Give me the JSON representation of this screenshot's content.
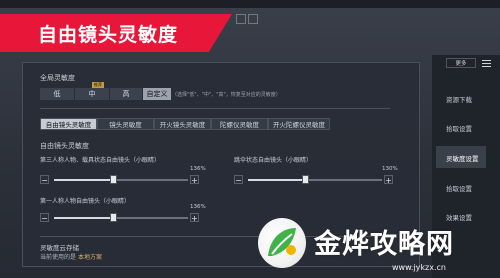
{
  "header": {
    "title": "自由镜头灵敏度"
  },
  "panel": {
    "global_label": "全局灵敏度",
    "presets": [
      {
        "label": "低",
        "active": false
      },
      {
        "label": "中",
        "active": false,
        "badge": "推荐"
      },
      {
        "label": "高",
        "active": false
      },
      {
        "label": "自定义",
        "active": true
      }
    ],
    "preset_note": "（选择\"低\"、\"中\"、\"高\"，恢复至对应的灵敏度）",
    "tabs": [
      {
        "label": "自由镜头灵敏度",
        "active": true
      },
      {
        "label": "镜头灵敏度",
        "active": false
      },
      {
        "label": "开火镜头灵敏度",
        "active": false
      },
      {
        "label": "陀螺仪灵敏度",
        "active": false
      },
      {
        "label": "开火陀螺仪灵敏度",
        "active": false
      }
    ],
    "sub_label": "自由镜头灵敏度",
    "sliders": [
      {
        "label": "第三人称人物、载具状态自由镜头（小眼睛）",
        "value_text": "136%",
        "value": 136,
        "min": 0,
        "max": 400
      },
      {
        "label": "跳伞状态自由镜头（小眼睛）",
        "value_text": "130%",
        "value": 130,
        "min": 0,
        "max": 400
      },
      {
        "label": "第一人称人物自由镜头（小眼睛）",
        "value_text": "136%",
        "value": 136,
        "min": 0,
        "max": 400
      }
    ],
    "cloud": {
      "title": "灵敏度云存储",
      "prefix": "当前使用的是",
      "link": "本地方案"
    }
  },
  "sidebar": {
    "top_button": "更多",
    "items": [
      {
        "label": "资源下载",
        "active": false
      },
      {
        "label": "拾取设置",
        "active": false
      },
      {
        "label": "灵敏度设置",
        "active": true
      },
      {
        "label": "拾取设置",
        "active": false
      },
      {
        "label": "效果设置",
        "active": false
      }
    ]
  },
  "watermark": {
    "text": "金烨攻略网",
    "url": "www.jykzx.cn"
  },
  "colors": {
    "accent": "#e8173a",
    "panel": "#282d36",
    "text": "#d6dbe2"
  }
}
